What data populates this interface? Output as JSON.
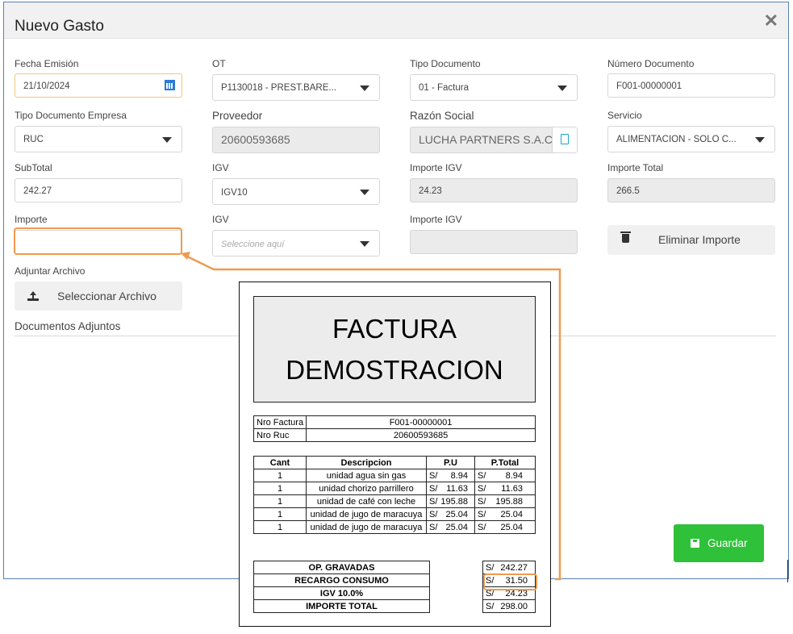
{
  "modal": {
    "title": "Nuevo Gasto",
    "close_glyph": "✕"
  },
  "form": {
    "fecha_emision": {
      "label": "Fecha Emisión",
      "value": "21/10/2024"
    },
    "ot": {
      "label": "OT",
      "value": "P1130018 - PREST.BARE..."
    },
    "tipo_documento": {
      "label": "Tipo Documento",
      "value": "01 - Factura"
    },
    "numero_documento": {
      "label": "Número Documento",
      "value": "F001-00000001"
    },
    "tipo_documento_empresa": {
      "label": "Tipo Documento Empresa",
      "value": "RUC"
    },
    "proveedor": {
      "label": "Proveedor",
      "value": "20600593685"
    },
    "razon_social": {
      "label": "Razón Social",
      "value": "LUCHA PARTNERS S.A.C"
    },
    "servicio": {
      "label": "Servicio",
      "value": "ALIMENTACION - SOLO C..."
    },
    "subtotal": {
      "label": "SubTotal",
      "value": "242.27"
    },
    "igv": {
      "label": "IGV",
      "value": "IGV10"
    },
    "importe_igv": {
      "label": "Importe IGV",
      "value": "24.23"
    },
    "importe_total": {
      "label": "Importe Total",
      "value": "266.5"
    },
    "importe": {
      "label": "Importe",
      "value": ""
    },
    "igv2": {
      "label": "IGV",
      "placeholder": "Seleccione aquí"
    },
    "importe_igv2": {
      "label": "Importe IGV",
      "value": ""
    },
    "eliminar_importe": "Eliminar Importe",
    "adjuntar_label": "Adjuntar Archivo",
    "seleccionar_archivo": "Seleccionar Archivo",
    "documentos_adjuntos": "Documentos Adjuntos",
    "guardar": "Guardar"
  },
  "invoice": {
    "title_line1": "FACTURA",
    "title_line2": "DEMOSTRACION",
    "nro_factura_label": "Nro Factura",
    "nro_factura": "F001-00000001",
    "nro_ruc_label": "Nro Ruc",
    "nro_ruc": "20600593685",
    "headers": {
      "cant": "Cant",
      "descripcion": "Descripcion",
      "pu": "P.U",
      "ptotal": "P.Total"
    },
    "currency": "S/",
    "items": [
      {
        "cant": "1",
        "desc": "unidad agua sin gas",
        "pu": "8.94",
        "total": "8.94"
      },
      {
        "cant": "1",
        "desc": "unidad chorizo parrillero",
        "pu": "11.63",
        "total": "11.63"
      },
      {
        "cant": "1",
        "desc": "unidad de café con leche",
        "pu": "195.88",
        "total": "195.88"
      },
      {
        "cant": "1",
        "desc": "unidad de jugo de maracuya",
        "pu": "25.04",
        "total": "25.04"
      },
      {
        "cant": "1",
        "desc": "unidad de jugo de maracuya",
        "pu": "25.04",
        "total": "25.04"
      }
    ],
    "summary": [
      {
        "label": "OP. GRAVADAS",
        "value": "242.27"
      },
      {
        "label": "RECARGO CONSUMO",
        "value": "31.50"
      },
      {
        "label": "IGV 10.0%",
        "value": "24.23"
      },
      {
        "label": "IMPORTE TOTAL",
        "value": "298.00"
      }
    ]
  },
  "colors": {
    "accent_highlight": "#ed9b50",
    "save_green": "#2fc13a",
    "modal_border": "#5b7fb5",
    "calendar_blue": "#2a7bd6"
  }
}
